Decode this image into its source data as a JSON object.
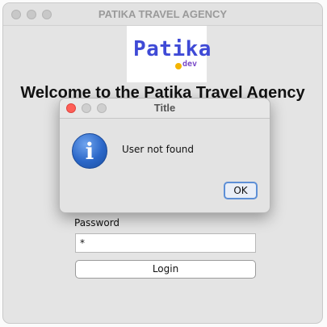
{
  "window": {
    "title": "PATIKA TRAVEL AGENCY",
    "logo": {
      "word": "Patika",
      "sub": "dev"
    },
    "welcome": "Welcome to the Patika Travel Agency",
    "password_label": "Password",
    "password_value": "*",
    "login_label": "Login"
  },
  "dialog": {
    "title": "Title",
    "icon": "info-icon",
    "icon_glyph": "i",
    "message": "User not found",
    "ok_label": "OK"
  }
}
